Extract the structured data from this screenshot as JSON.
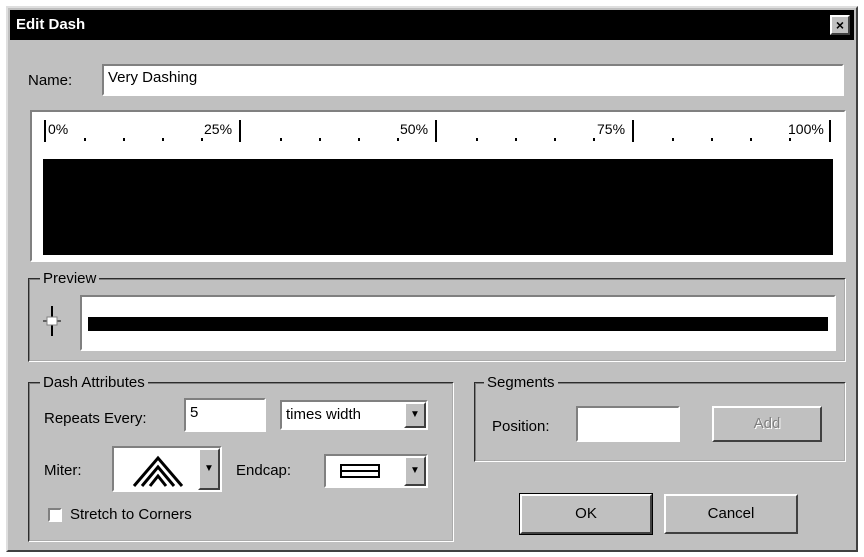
{
  "window": {
    "title": "Edit Dash",
    "close_glyph": "×"
  },
  "name_field": {
    "label": "Name:",
    "value": "Very Dashing"
  },
  "ruler": {
    "labels": [
      "0%",
      "25%",
      "50%",
      "75%",
      "100%"
    ]
  },
  "preview": {
    "group_title": "Preview"
  },
  "dash_attributes": {
    "group_title": "Dash Attributes",
    "repeats_label": "Repeats Every:",
    "repeats_value": "5",
    "unit_selected": "times width",
    "miter_label": "Miter:",
    "endcap_label": "Endcap:",
    "stretch_label": "Stretch to Corners"
  },
  "segments": {
    "group_title": "Segments",
    "position_label": "Position:",
    "position_value": "",
    "add_label": "Add"
  },
  "buttons": {
    "ok_label": "OK",
    "cancel_label": "Cancel"
  },
  "colors": {
    "title_bar": "#000000",
    "face": "#c0c0c0",
    "dash": "#000000"
  }
}
